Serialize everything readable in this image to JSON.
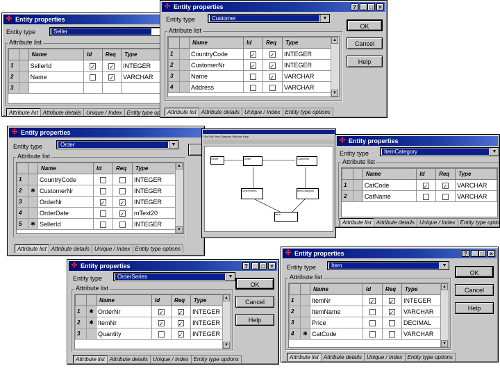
{
  "common": {
    "entity_type_label": "Entity type",
    "attribute_list_label": "Attribute list",
    "col_name": "Name",
    "col_id": "Id",
    "col_req": "Req",
    "col_type": "Type",
    "ok": "OK",
    "cancel": "Cancel",
    "help": "Help",
    "tabs": [
      "Attribute list",
      "Attribute details",
      "Unique / Index",
      "Entity type options"
    ],
    "help_glyph": "?",
    "min_glyph": "_",
    "max_glyph": "□",
    "close_glyph": "×"
  },
  "dialogs": [
    {
      "id": "seller",
      "title": "Entity properties",
      "entity_type": "Seller",
      "rows": [
        {
          "num": "1",
          "key": "",
          "name": "SellerId",
          "id": true,
          "req": true,
          "type": "INTEGER"
        },
        {
          "num": "2",
          "key": "",
          "name": "Name",
          "id": false,
          "req": true,
          "type": "VARCHAR"
        },
        {
          "num": "3",
          "key": "",
          "name": "",
          "id": false,
          "req": false,
          "type": ""
        }
      ]
    },
    {
      "id": "customer",
      "title": "Entity properties",
      "entity_type": "Customer",
      "rows": [
        {
          "num": "1",
          "key": "",
          "name": "CountryCode",
          "id": true,
          "req": true,
          "type": "INTEGER"
        },
        {
          "num": "2",
          "key": "",
          "name": "CustomerNr",
          "id": true,
          "req": true,
          "type": "INTEGER"
        },
        {
          "num": "3",
          "key": "",
          "name": "Name",
          "id": false,
          "req": true,
          "type": "VARCHAR"
        },
        {
          "num": "4",
          "key": "",
          "name": "Address",
          "id": false,
          "req": false,
          "type": "VARCHAR"
        }
      ]
    },
    {
      "id": "order",
      "title": "Entity properties",
      "entity_type": "Order",
      "rows": [
        {
          "num": "1",
          "key": "",
          "name": "CountryCode",
          "id": false,
          "req": false,
          "type": "INTEGER"
        },
        {
          "num": "2",
          "key": "✱",
          "name": "CustomerNr",
          "id": false,
          "req": false,
          "type": "INTEGER"
        },
        {
          "num": "3",
          "key": "",
          "name": "OrderNr",
          "id": true,
          "req": true,
          "type": "INTEGER"
        },
        {
          "num": "4",
          "key": "",
          "name": "OrderDate",
          "id": false,
          "req": true,
          "type": "mText20"
        },
        {
          "num": "5",
          "key": "✱",
          "name": "SellerId",
          "id": false,
          "req": false,
          "type": "INTEGER"
        }
      ]
    },
    {
      "id": "itemcategory",
      "title": "Entity properties",
      "entity_type": "ItemCategory",
      "rows": [
        {
          "num": "1",
          "key": "",
          "name": "CatCode",
          "id": true,
          "req": true,
          "type": "VARCHAR"
        },
        {
          "num": "2",
          "key": "",
          "name": "CatName",
          "id": false,
          "req": false,
          "type": "VARCHAR"
        }
      ]
    },
    {
      "id": "orderseries",
      "title": "Entity properties",
      "entity_type": "OrderSeries",
      "rows": [
        {
          "num": "1",
          "key": "✱",
          "name": "OrderNr",
          "id": true,
          "req": true,
          "type": "INTEGER"
        },
        {
          "num": "2",
          "key": "✱",
          "name": "ItemNr",
          "id": true,
          "req": true,
          "type": "INTEGER"
        },
        {
          "num": "3",
          "key": "",
          "name": "Quantity",
          "id": false,
          "req": true,
          "type": "INTEGER"
        }
      ]
    },
    {
      "id": "item",
      "title": "Entity properties",
      "entity_type": "Item",
      "rows": [
        {
          "num": "1",
          "key": "",
          "name": "ItemNr",
          "id": true,
          "req": true,
          "type": "INTEGER"
        },
        {
          "num": "2",
          "key": "",
          "name": "ItemName",
          "id": false,
          "req": true,
          "type": "VARCHAR"
        },
        {
          "num": "3",
          "key": "",
          "name": "Price",
          "id": false,
          "req": false,
          "type": "DECIMAL"
        },
        {
          "num": "4",
          "key": "✱",
          "name": "CatCode",
          "id": false,
          "req": false,
          "type": "VARCHAR"
        }
      ]
    }
  ],
  "app": {
    "menu": "File Edit View Diagram Window Help",
    "entities": [
      "Seller",
      "Order",
      "Customer",
      "OrderSeries",
      "Item",
      "ItemCategory"
    ]
  },
  "colors": {
    "title_blue": "#0a1f8f",
    "face": "#c7c7c7",
    "icon_red": "#ff3030"
  }
}
